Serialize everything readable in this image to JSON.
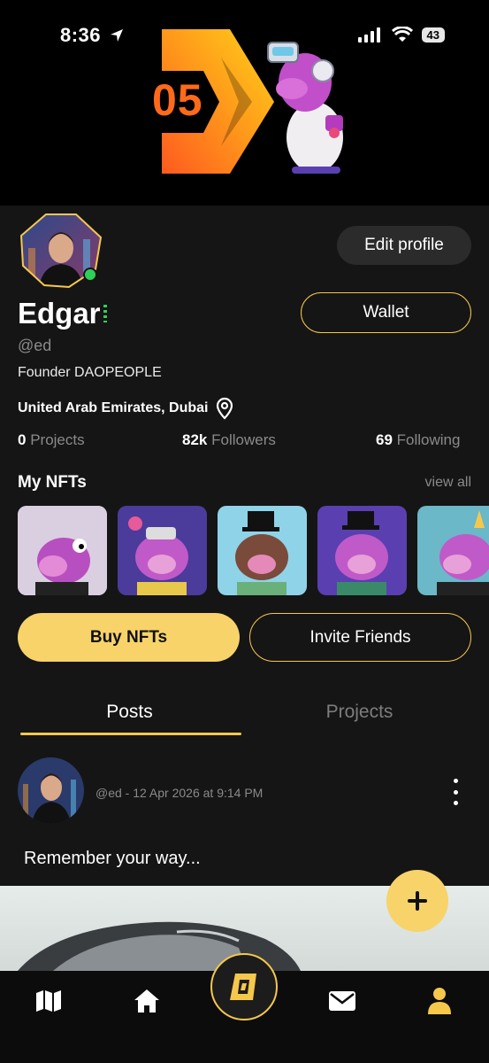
{
  "status_bar": {
    "time": "8:36",
    "battery": "43"
  },
  "banner": {
    "badge_number": "05"
  },
  "profile": {
    "name": "Edgar",
    "handle": "@ed",
    "bio": "Founder DAOPEOPLE",
    "location": "United Arab Emirates, Dubai",
    "edit_label": "Edit profile",
    "wallet_label": "Wallet",
    "stats": {
      "projects_count": "0",
      "projects_label": "Projects",
      "followers_count": "82k",
      "followers_label": "Followers",
      "following_count": "69",
      "following_label": "Following"
    }
  },
  "nfts": {
    "title": "My NFTs",
    "view_all": "view all"
  },
  "actions": {
    "buy_label": "Buy NFTs",
    "invite_label": "Invite Friends"
  },
  "tabs": {
    "posts": "Posts",
    "projects": "Projects"
  },
  "post": {
    "meta": "@ed - 12 Apr 2026 at 9:14 PM",
    "text": "Remember your way..."
  },
  "colors": {
    "accent": "#f5c84c",
    "button_fill": "#f7d36a",
    "online": "#2ed158",
    "panel": "#151515"
  },
  "icons": {
    "nav": [
      "map-icon",
      "home-icon",
      "dao-logo-icon",
      "mail-icon",
      "profile-icon"
    ],
    "fab": "plus-icon"
  }
}
